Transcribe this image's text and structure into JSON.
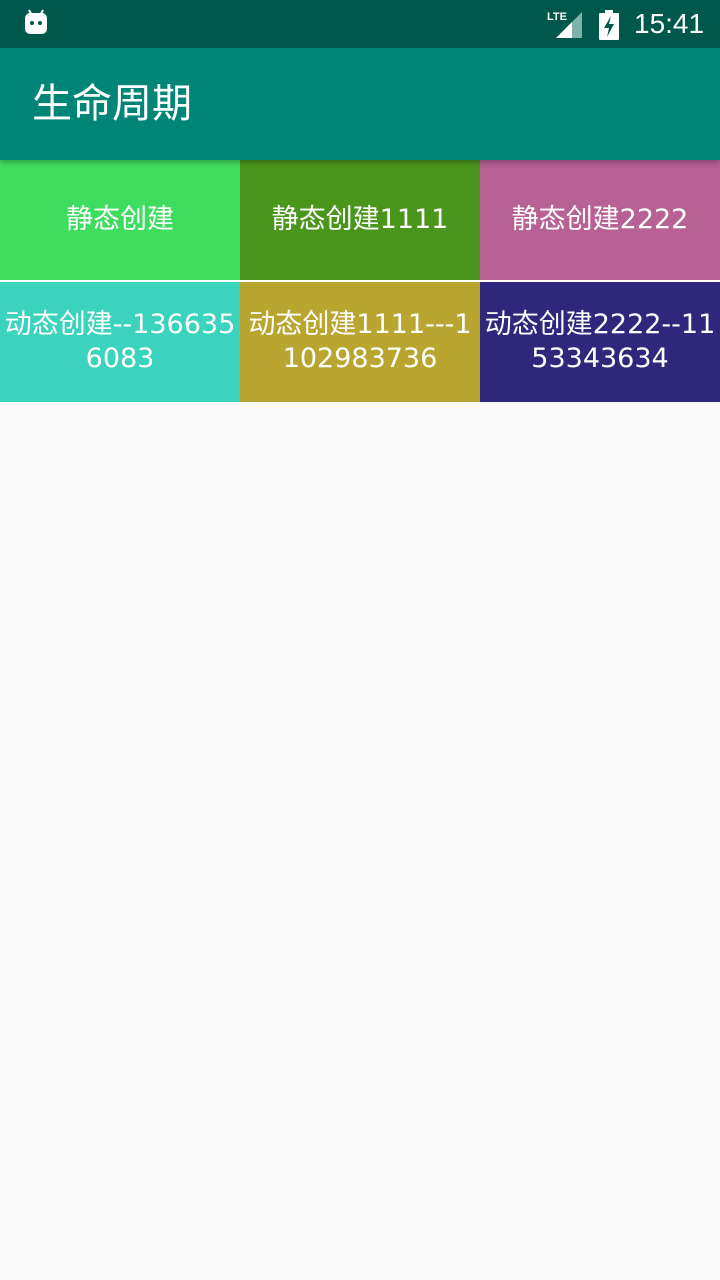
{
  "status_bar": {
    "time": "15:41",
    "network": "LTE",
    "icons": [
      "android-icon",
      "lte-signal-icon",
      "battery-charging-icon"
    ]
  },
  "app_bar": {
    "title": "生命周期",
    "color": "#008577"
  },
  "tiles": [
    {
      "label": "静态创建",
      "color": "#3fdd5f"
    },
    {
      "label": "静态创建1111",
      "color": "#4a961d"
    },
    {
      "label": "静态创建2222",
      "color": "#b76195"
    },
    {
      "label": "动态创建--1366356083",
      "color": "#3bd3bd"
    },
    {
      "label": "动态创建1111---1102983736",
      "color": "#b9a630"
    },
    {
      "label": "动态创建2222--1153343634",
      "color": "#2e277c"
    }
  ]
}
